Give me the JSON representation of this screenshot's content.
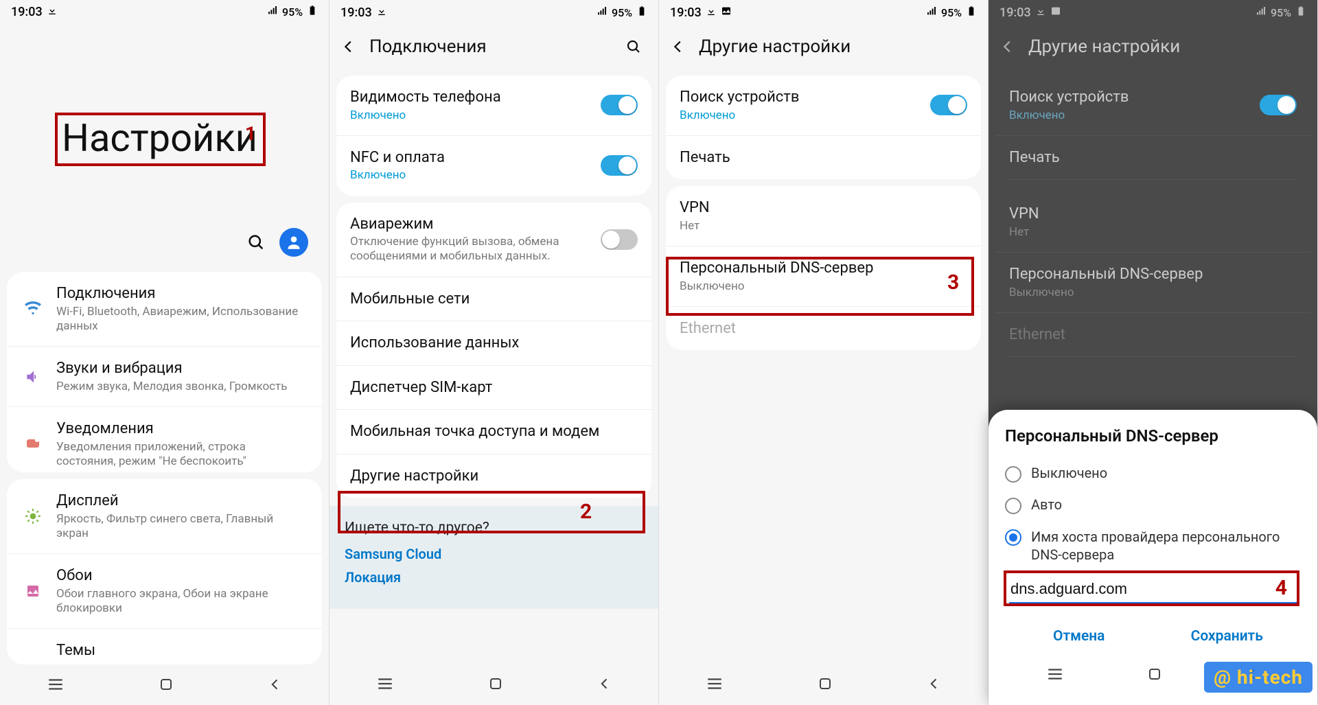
{
  "status": {
    "time": "19:03",
    "battery": "95%"
  },
  "screen1": {
    "title": "Настройки",
    "marker": "1",
    "items": [
      {
        "title": "Подключения",
        "sub": "Wi-Fi, Bluetooth, Авиарежим, Использование данных",
        "icon": "wifi",
        "color": "#3b8bd6"
      },
      {
        "title": "Звуки и вибрация",
        "sub": "Режим звука, Мелодия звонка, Громкость",
        "icon": "sound",
        "color": "#a06fd1"
      },
      {
        "title": "Уведомления",
        "sub": "Уведомления приложений, строка состояния, режим \"Не беспокоить\"",
        "icon": "notif",
        "color": "#e37a6e"
      },
      {
        "title": "Дисплей",
        "sub": "Яркость, Фильтр синего света, Главный экран",
        "icon": "display",
        "color": "#7db63f"
      },
      {
        "title": "Обои",
        "sub": "Обои главного экрана, Обои на экране блокировки",
        "icon": "wall",
        "color": "#d66aa8"
      },
      {
        "title": "Темы",
        "sub": "",
        "icon": "theme",
        "color": "#888"
      }
    ]
  },
  "screen2": {
    "title": "Подключения",
    "marker": "2",
    "group1": [
      {
        "title": "Видимость телефона",
        "sub": "Включено",
        "sub_on": true,
        "toggle": true
      },
      {
        "title": "NFC и оплата",
        "sub": "Включено",
        "sub_on": true,
        "toggle": true
      }
    ],
    "group2": [
      {
        "title": "Авиарежим",
        "sub": "Отключение функций вызова, обмена сообщениями и мобильных данных.",
        "toggle": false
      },
      {
        "title": "Мобильные сети"
      },
      {
        "title": "Использование данных"
      },
      {
        "title": "Диспетчер SIM-карт"
      },
      {
        "title": "Мобильная точка доступа и модем"
      },
      {
        "title": "Другие настройки"
      }
    ],
    "suggest": {
      "q": "Ищете что-то другое?",
      "links": [
        "Samsung Cloud",
        "Локация"
      ]
    }
  },
  "screen3": {
    "title": "Другие настройки",
    "marker": "3",
    "group1": [
      {
        "title": "Поиск устройств",
        "sub": "Включено",
        "sub_on": true,
        "toggle": true
      },
      {
        "title": "Печать"
      }
    ],
    "group2": [
      {
        "title": "VPN",
        "sub": "Нет"
      },
      {
        "title": "Персональный DNS-сервер",
        "sub": "Выключено"
      },
      {
        "title": "Ethernet",
        "disabled": true
      }
    ]
  },
  "screen4": {
    "title": "Другие настройки",
    "group1": [
      {
        "title": "Поиск устройств",
        "sub": "Включено",
        "toggle": true
      },
      {
        "title": "Печать"
      }
    ],
    "group2": [
      {
        "title": "VPN",
        "sub": "Нет"
      },
      {
        "title": "Персональный DNS-сервер",
        "sub": "Выключено"
      },
      {
        "title": "Ethernet",
        "disabled": true
      }
    ],
    "dialog": {
      "title": "Персональный DNS-сервер",
      "options": [
        {
          "label": "Выключено",
          "sel": false
        },
        {
          "label": "Авто",
          "sel": false
        },
        {
          "label": "Имя хоста провайдера персонального DNS-сервера",
          "sel": true
        }
      ],
      "input_value": "dns.adguard.com",
      "marker": "4",
      "cancel": "Отмена",
      "save": "Сохранить"
    }
  },
  "badge": "@ hi-tech"
}
